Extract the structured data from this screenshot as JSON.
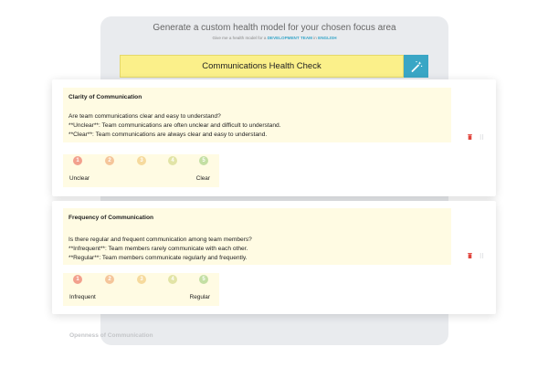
{
  "generator": {
    "title": "Generate a custom health model for your chosen focus area",
    "subtitle_prefix": "Give me a health model for a",
    "team_link": "DEVELOPMENT TEAM",
    "subtitle_join": "in",
    "language_link": "ENGLISH",
    "model_title": "Communications Health Check",
    "magic_icon": "magic-wand-icon"
  },
  "cards": [
    {
      "title": "Clarity of Communication",
      "question": "Are team communications clear and easy to understand?",
      "low_desc": "**Unclear**: Team communications are often unclear and difficult to understand.",
      "high_desc": "**Clear**: Team communications are always clear and easy to understand.",
      "scale": [
        "1",
        "2",
        "3",
        "4",
        "5"
      ],
      "low_label": "Unclear",
      "high_label": "Clear"
    },
    {
      "title": "Frequency of Communication",
      "question": "Is there regular and frequent communication among team members?",
      "low_desc": "**Infrequent**: Team members rarely communicate with each other.",
      "high_desc": "**Regular**: Team members communicate regularly and frequently.",
      "scale": [
        "1",
        "2",
        "3",
        "4",
        "5"
      ],
      "low_label": "Infrequent",
      "high_label": "Regular"
    }
  ],
  "next_card_title": "Openness of Communication",
  "colors": {
    "scale_1": "#f2a08d",
    "scale_2": "#f5c59a",
    "scale_3": "#f6da9d",
    "scale_4": "#e2e4a6",
    "scale_5": "#c3dfa3",
    "accent": "#3aa6c5",
    "title_bg": "#fbf08a",
    "note_bg": "#fffbe3",
    "delete": "#e0443c"
  }
}
